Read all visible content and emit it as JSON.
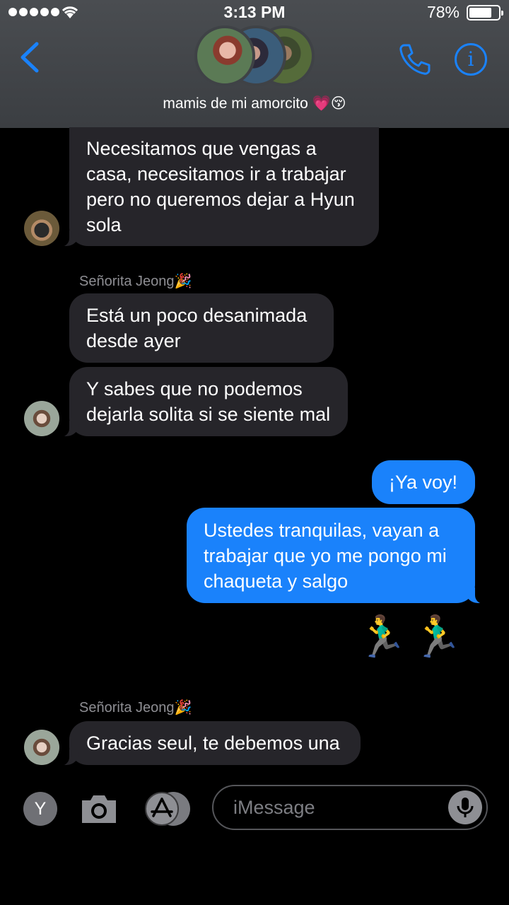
{
  "status_bar": {
    "time": "3:13 PM",
    "battery_percent": "78%",
    "battery_level": 0.78,
    "signal_bars": 5
  },
  "header": {
    "chat_title": "mamis de mi amorcito 💗😚",
    "back_icon": "chevron-left-icon",
    "call_icon": "phone-icon",
    "info_icon": "info-icon",
    "info_glyph": "i",
    "accent_color": "#1a82fb"
  },
  "messages": [
    {
      "direction": "incoming",
      "lines": [
        "Necesitamos que vengas a",
        "casa, necesitamos ir a trabajar",
        "pero no queremos dejar a Hyun",
        "sola"
      ]
    },
    {
      "direction": "incoming",
      "sender": "Señorita Jeong🎉",
      "lines": [
        "Está un poco desanimada",
        "desde ayer"
      ]
    },
    {
      "direction": "incoming",
      "lines": [
        "Y sabes que no podemos",
        "dejarla solita si se siente mal"
      ]
    },
    {
      "direction": "outgoing",
      "lines": [
        "¡Ya voy!"
      ]
    },
    {
      "direction": "outgoing",
      "lines": [
        "Ustedes tranquilas, vayan a",
        "trabajar que yo me pongo mi",
        "chaqueta y salgo"
      ]
    },
    {
      "direction": "outgoing",
      "emoji": "🏃‍♂️🏃‍♂️"
    },
    {
      "direction": "incoming",
      "sender": "Señorita Jeong🎉",
      "lines": [
        "Gracias seul, te debemos una"
      ]
    }
  ],
  "input_bar": {
    "y_button_label": "Y",
    "camera_icon": "camera-icon",
    "apps_icon": "app-store-icon",
    "placeholder": "iMessage",
    "mic_icon": "microphone-icon"
  }
}
